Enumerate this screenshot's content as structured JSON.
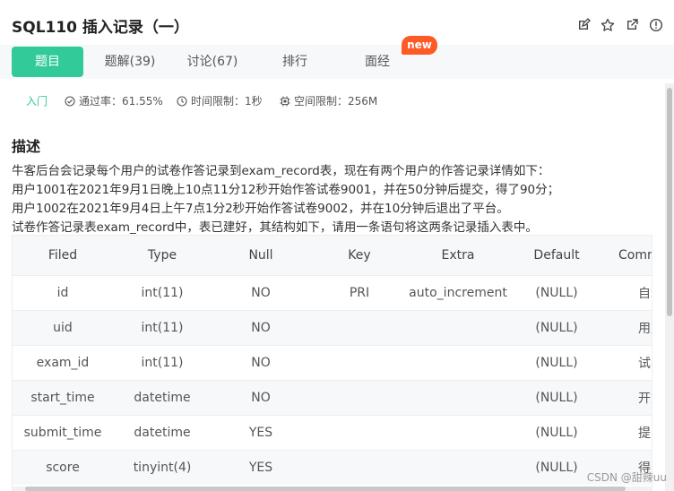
{
  "header": {
    "title": "SQL110  插入记录（一）",
    "icons": [
      "edit-icon",
      "star-icon",
      "share-icon",
      "info-icon"
    ]
  },
  "tabs": [
    {
      "label": "题目",
      "active": true
    },
    {
      "label": "题解(39)",
      "active": false
    },
    {
      "label": "讨论(67)",
      "active": false
    },
    {
      "label": "排行",
      "active": false
    },
    {
      "label": "面经",
      "active": false
    }
  ],
  "badge": "new",
  "meta": {
    "level": "入门",
    "pass_rate": "通过率：61.55%",
    "time_limit": "时间限制：1秒",
    "space_limit": "空间限制：256M"
  },
  "description": {
    "title": "描述",
    "lines": [
      "牛客后台会记录每个用户的试卷作答记录到exam_record表，现在有两个用户的作答记录详情如下：",
      "用户1001在2021年9月1日晚上10点11分12秒开始作答试卷9001，并在50分钟后提交，得了90分；",
      "用户1002在2021年9月4日上午7点1分2秒开始作答试卷9002，并在10分钟后退出了平台。",
      "试卷作答记录表exam_record中，表已建好，其结构如下，请用一条语句将这两条记录插入表中。"
    ]
  },
  "table": {
    "headers": [
      "Filed",
      "Type",
      "Null",
      "Key",
      "Extra",
      "Default",
      "Comment"
    ],
    "rows": [
      [
        "id",
        "int(11)",
        "NO",
        "PRI",
        "auto_increment",
        "(NULL)",
        "自增ID"
      ],
      [
        "uid",
        "int(11)",
        "NO",
        "",
        "",
        "(NULL)",
        "用户ID"
      ],
      [
        "exam_id",
        "int(11)",
        "NO",
        "",
        "",
        "(NULL)",
        "试卷ID"
      ],
      [
        "start_time",
        "datetime",
        "NO",
        "",
        "",
        "(NULL)",
        "开始时间"
      ],
      [
        "submit_time",
        "datetime",
        "YES",
        "",
        "",
        "(NULL)",
        "提交时间"
      ],
      [
        "score",
        "tinyint(4)",
        "YES",
        "",
        "",
        "(NULL)",
        "得分"
      ]
    ]
  },
  "watermark": "CSDN @甜辣uu",
  "colors": {
    "accent": "#32ca99",
    "new_badge": "#fe5a26",
    "tab_bar_bg": "#f7f8fa"
  }
}
